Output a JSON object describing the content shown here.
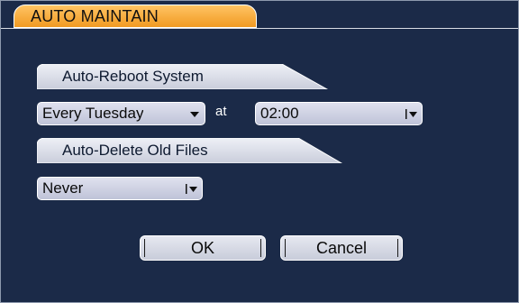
{
  "dialog": {
    "title": "AUTO MAINTAIN"
  },
  "reboot_section": {
    "header": "Auto-Reboot System",
    "day_select": {
      "value": "Every Tuesday"
    },
    "at_label": "at",
    "time_select": {
      "value": "02:00"
    }
  },
  "delete_section": {
    "header": "Auto-Delete Old Files",
    "select": {
      "value": "Never"
    }
  },
  "buttons": {
    "ok": "OK",
    "cancel": "Cancel"
  },
  "colors": {
    "background": "#1b2a48",
    "title_tab": "#f5a733",
    "control_fill": "#cdd0e2"
  },
  "icons": {
    "dropdown": "chevron-down-icon"
  }
}
